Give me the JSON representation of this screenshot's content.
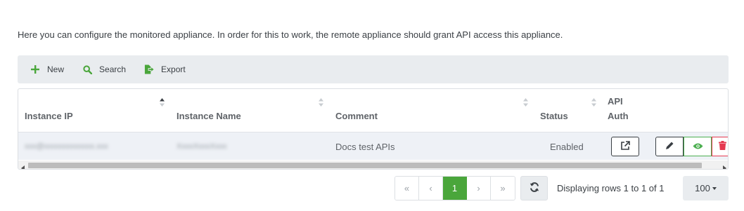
{
  "intro": "Here you can configure the monitored appliance. In order for this to work, the remote appliance should grant API access this appliance.",
  "toolbar": {
    "new_label": "New",
    "search_label": "Search",
    "export_label": "Export"
  },
  "table": {
    "columns": {
      "instance_ip": "Instance IP",
      "instance_name": "Instance Name",
      "comment": "Comment",
      "status": "Status",
      "api_auth_line1": "API",
      "api_auth_line2": "Auth"
    },
    "rows": [
      {
        "instance_ip": "xxx@xxxxxxxxxxxxx.xxx",
        "instance_name": "XxxxXxxxXxxx",
        "comment": "Docs test APIs",
        "status": "Enabled"
      }
    ]
  },
  "pagination": {
    "first": "«",
    "prev": "‹",
    "current": "1",
    "next": "›",
    "last": "»",
    "info": "Displaying rows 1 to 1 of 1",
    "page_size": "100"
  },
  "colors": {
    "accent_green": "#4aa63b",
    "danger_red": "#e53950",
    "view_green": "#4caf50"
  }
}
